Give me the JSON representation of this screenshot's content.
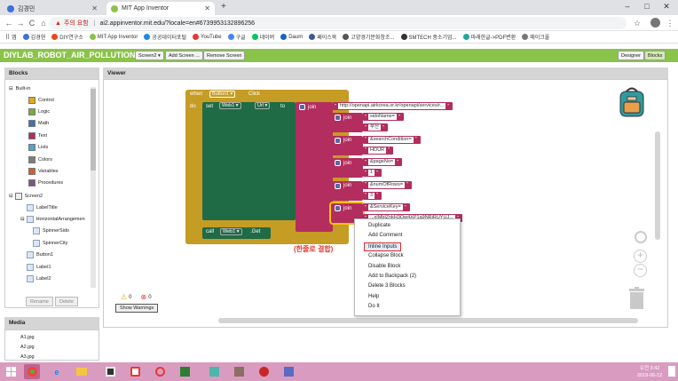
{
  "browser": {
    "tabs": [
      {
        "label": "김경민",
        "active": false
      },
      {
        "label": "MIT App Inventor",
        "active": true
      }
    ],
    "new_tab": "+",
    "win_minimize": "–",
    "win_maximize": "□",
    "win_close": "✕",
    "nav_back": "←",
    "nav_forward": "→",
    "nav_reload": "C",
    "nav_home": "⌂",
    "security_warning": "주의 요함",
    "url": "ai2.appinventor.mit.edu/?locale=en#6739953132896256",
    "star_icon": "☆",
    "menu_dots": "⋮"
  },
  "bookmarks": {
    "apps_label": "앱",
    "items": [
      {
        "label": "김경현",
        "color": "#3f6fd8"
      },
      {
        "label": "DIY연구소",
        "color": "#e64a19"
      },
      {
        "label": "MIT App Inventor",
        "color": "#8bc34a"
      },
      {
        "label": "공공데이터포털",
        "color": "#1e88e5"
      },
      {
        "label": "YouTube",
        "color": "#e53935"
      },
      {
        "label": "구글",
        "color": "#4285f4"
      },
      {
        "label": "네이버",
        "color": "#03c75a"
      },
      {
        "label": "Daum",
        "color": "#1565c0"
      },
      {
        "label": "페이스북",
        "color": "#3b5998"
      },
      {
        "label": "고양경기문화창조...",
        "color": "#555555"
      },
      {
        "label": "SMTECH 중소기업...",
        "color": "#333333"
      },
      {
        "label": "마래한글->PDF변환",
        "color": "#26a69a"
      },
      {
        "label": "메이크올",
        "color": "#777777"
      }
    ]
  },
  "app": {
    "project_name": "DIYLAB_ROBOT_AIR_POLLUTION1",
    "screen_select": "Screen2 ▾",
    "add_screen": "Add Screen ...",
    "remove_screen": "Remove Screen",
    "designer": "Designer",
    "blocks": "Blocks"
  },
  "blocks_panel": {
    "title": "Blocks",
    "builtin": "Built-in",
    "builtin_items": [
      {
        "label": "Control",
        "color": "#e1a91a"
      },
      {
        "label": "Logic",
        "color": "#77ab41"
      },
      {
        "label": "Math",
        "color": "#3f71b5"
      },
      {
        "label": "Text",
        "color": "#b32d5e"
      },
      {
        "label": "Lists",
        "color": "#49a6d4"
      },
      {
        "label": "Colors",
        "color": "#7d7d7d"
      },
      {
        "label": "Variables",
        "color": "#d05f2d"
      },
      {
        "label": "Procedures",
        "color": "#7c5385"
      }
    ],
    "screen": "Screen2",
    "components": [
      {
        "label": "LabelTitle",
        "indent": 2
      },
      {
        "label": "HorizontalArrangemen",
        "indent": 1
      },
      {
        "label": "SpinnerSido",
        "indent": 3
      },
      {
        "label": "SpinnerCity",
        "indent": 3
      },
      {
        "label": "Button1",
        "indent": 2
      },
      {
        "label": "Label1",
        "indent": 2
      },
      {
        "label": "Label2",
        "indent": 2
      }
    ],
    "rename": "Rename",
    "delete": "Delete"
  },
  "media_panel": {
    "title": "Media",
    "items": [
      "A1.jpg",
      "A2.jpg",
      "A3.jpg"
    ]
  },
  "viewer": {
    "title": "Viewer",
    "event_when": "when",
    "event_component": "Button1 ▾",
    "event_name": "Click",
    "do": "do",
    "set": "set",
    "set_component": "Web1 ▾",
    "set_property": "Url ▾",
    "to": "to",
    "join": "join",
    "url_value": "http://openapi.airkorea.or.kr/openapi/services/r...",
    "joins": [
      {
        "a": "sidoName=",
        "b": "부산"
      },
      {
        "a": "&searchCondition=",
        "b": "HOUR"
      },
      {
        "a": "&pageNo=",
        "b": "1"
      },
      {
        "a": "&numOfRows=",
        "b": "3"
      },
      {
        "a": "&ServiceKey=",
        "b": "...xIMblZnkH3Qw4XP1a9NRiRUYUJ..."
      }
    ],
    "call": "call",
    "call_component": "Web1 ▾",
    "call_method": ".Get",
    "annotation": "(한줄로 결합)",
    "warnings_count": "0",
    "errors_count": "0",
    "show_warnings": "Show Warnings"
  },
  "context_menu": {
    "items": [
      "Duplicate",
      "Add Comment",
      "Inline Inputs",
      "Collapse Block",
      "Disable Block",
      "Add to Backpack (2)",
      "Delete 3 Blocks",
      "Help",
      "Do It"
    ],
    "highlighted": "Inline Inputs"
  },
  "taskbar": {
    "start_icon": "windows-logo-icon",
    "time": "오전 3:42",
    "date": "2019-06-12"
  },
  "colors": {
    "app_green": "#8bc34a",
    "event_block": "#c59c24",
    "component_block": "#1e6b46",
    "text_block": "#b32d5e",
    "annotation_red": "#e53935",
    "taskbar": "#d99cc0"
  }
}
